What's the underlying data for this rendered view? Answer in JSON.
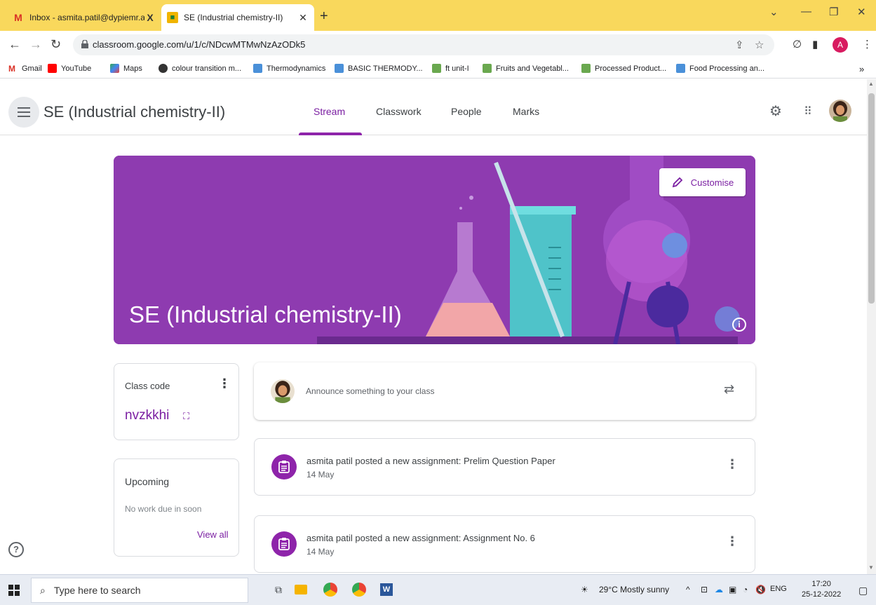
{
  "browser": {
    "tabs": [
      {
        "title": "Inbox - asmita.patil@dypiemr.ac",
        "close": "X"
      },
      {
        "title": "SE (Industrial chemistry-II)",
        "close": "✕"
      }
    ],
    "new_tab": "+",
    "address": "classroom.google.com/u/1/c/NDcwMTMwNzAzODk5",
    "profile_initial": "A",
    "bookmarks": [
      "Gmail",
      "YouTube",
      "Maps",
      "colour transition m...",
      "Thermodynamics",
      "BASIC THERMODY...",
      "ft unit-I",
      "Fruits and Vegetabl...",
      "Processed Product...",
      "Food Processing an..."
    ],
    "bookmarks_more": "»"
  },
  "classroom": {
    "class_title": "SE (Industrial chemistry-II)",
    "tabs": [
      "Stream",
      "Classwork",
      "People",
      "Marks"
    ],
    "active_tab": "Stream"
  },
  "banner": {
    "title": "SE (Industrial chemistry-II)",
    "customise_label": "Customise",
    "info": "i"
  },
  "class_code": {
    "label": "Class code",
    "value": "nvzkkhi"
  },
  "upcoming": {
    "title": "Upcoming",
    "note": "No work due in soon",
    "view_all": "View all"
  },
  "announce": {
    "placeholder": "Announce something to your class"
  },
  "posts": [
    {
      "title": "asmita patil posted a new assignment: Prelim Question Paper",
      "date": "14 May"
    },
    {
      "title": "asmita patil posted a new assignment: Assignment No. 6",
      "date": "14 May"
    }
  ],
  "taskbar": {
    "search_placeholder": "Type here to search",
    "weather": "29°C  Mostly sunny",
    "lang": "ENG",
    "time": "17:20",
    "date": "25-12-2022"
  },
  "colors": {
    "accent": "#7b1fa2",
    "banner": "#8e3bb0",
    "tabstrip": "#f9d85c"
  }
}
